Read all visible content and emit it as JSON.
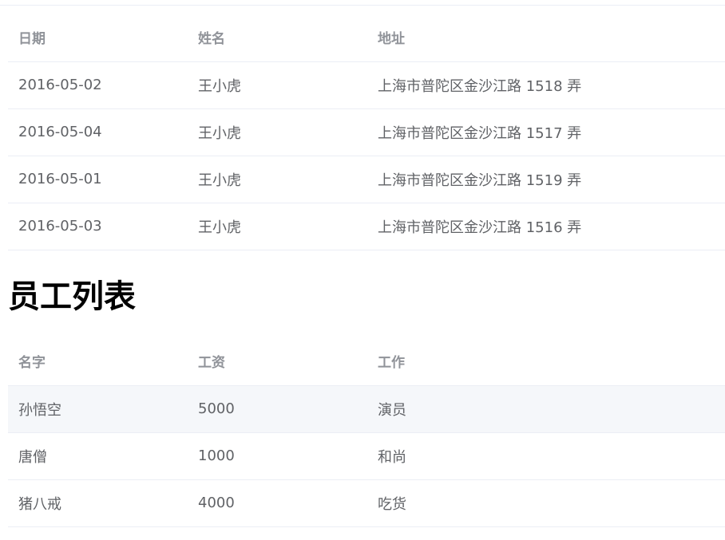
{
  "orders_table": {
    "columns": [
      "日期",
      "姓名",
      "地址"
    ],
    "rows": [
      [
        "2016-05-02",
        "王小虎",
        "上海市普陀区金沙江路 1518 弄"
      ],
      [
        "2016-05-04",
        "王小虎",
        "上海市普陀区金沙江路 1517 弄"
      ],
      [
        "2016-05-01",
        "王小虎",
        "上海市普陀区金沙江路 1519 弄"
      ],
      [
        "2016-05-03",
        "王小虎",
        "上海市普陀区金沙江路 1516 弄"
      ]
    ]
  },
  "staff_section": {
    "title": "员工列表"
  },
  "staff_table": {
    "columns": [
      "名字",
      "工资",
      "工作"
    ],
    "rows": [
      [
        "孙悟空",
        "5000",
        "演员"
      ],
      [
        "唐僧",
        "1000",
        "和尚"
      ],
      [
        "猪八戒",
        "4000",
        "吃货"
      ]
    ],
    "hovered_row": 0
  },
  "colors": {
    "header_text": "#909399",
    "cell_text": "#606266",
    "border": "#ebeef5",
    "hover_row_bg": "#f5f7fa",
    "title_text": "#000000"
  }
}
